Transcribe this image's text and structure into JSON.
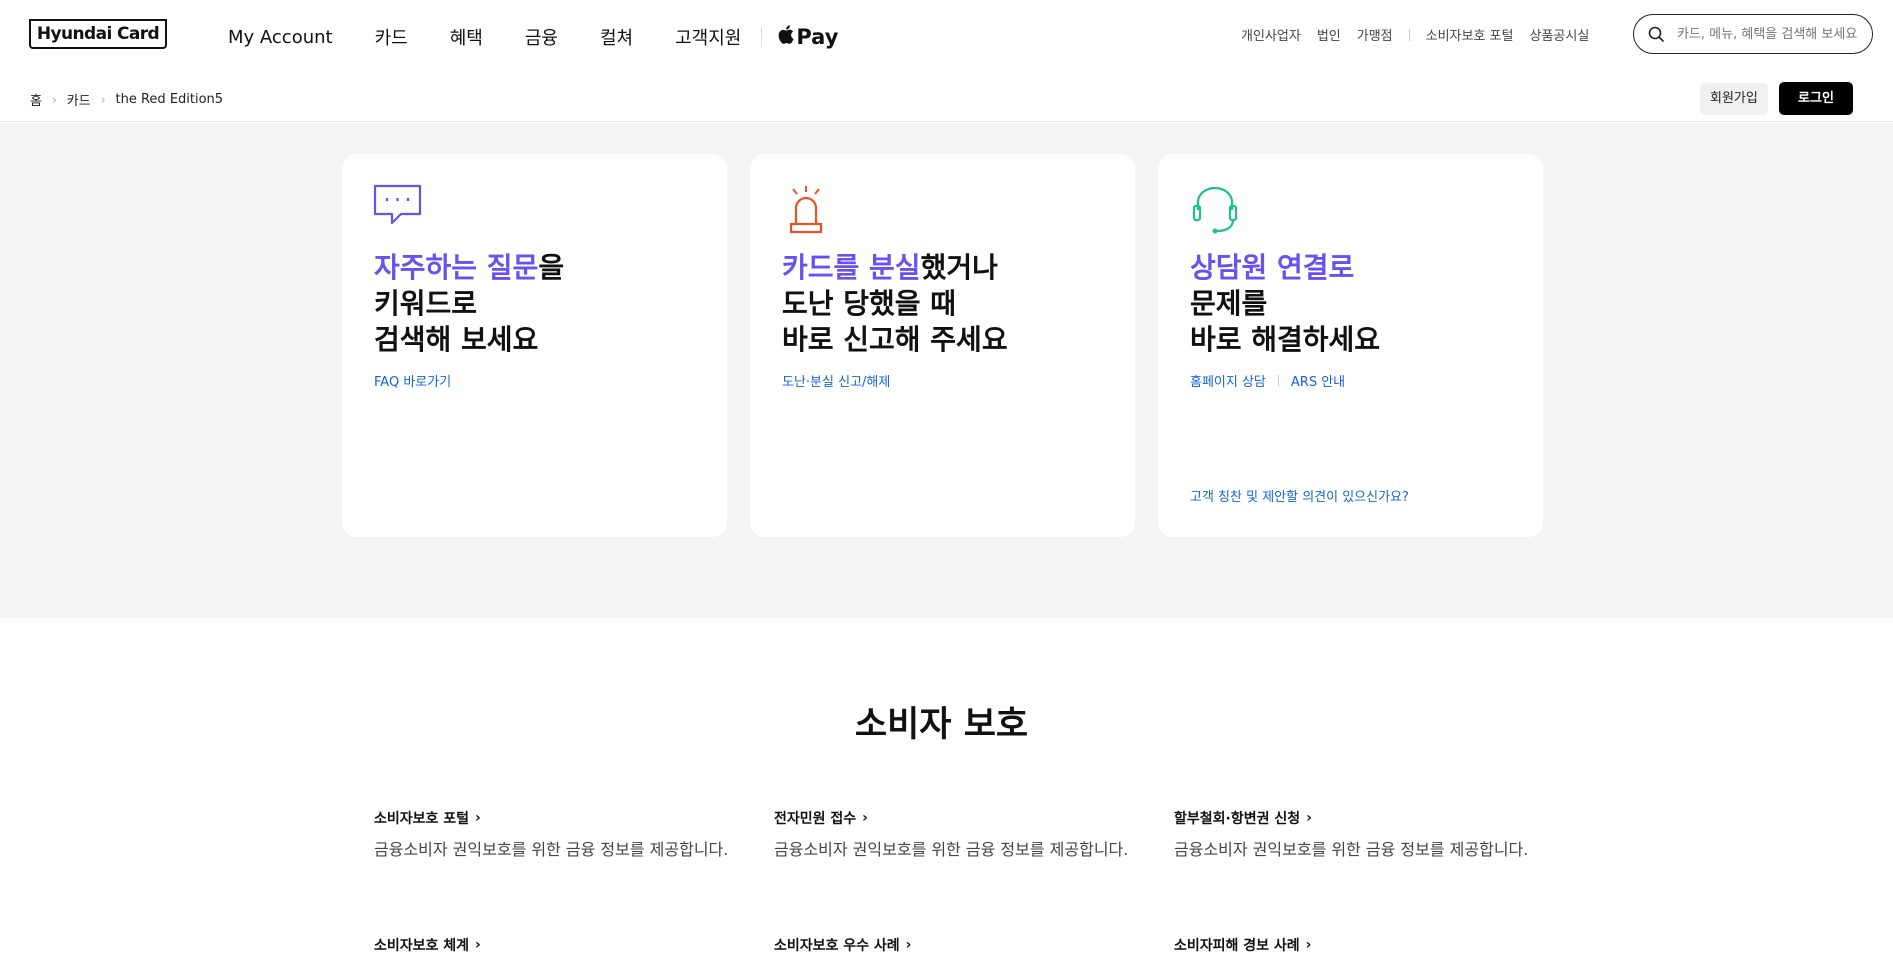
{
  "header": {
    "logo": "Hyundai Card",
    "nav": [
      "My Account",
      "카드",
      "혜택",
      "금융",
      "컬쳐",
      "고객지원"
    ],
    "applepay": "Pay",
    "util": [
      "개인사업자",
      "법인",
      "가맹점",
      "소비자보호 포털",
      "상품공시실"
    ],
    "search_placeholder": "카드, 메뉴, 혜택을 검색해 보세요"
  },
  "breadcrumb": [
    "홈",
    "카드",
    "the Red Edition5"
  ],
  "auth": {
    "join": "회원가입",
    "login": "로그인"
  },
  "cards": [
    {
      "title_hl": "자주하는 질문",
      "title_rest": "을",
      "line2": "키워드로",
      "line3": "검색해 보세요",
      "links": [
        "FAQ 바로가기"
      ]
    },
    {
      "title_hl": "카드를 분실",
      "title_rest": "했거나",
      "line2": "도난 당했을 때",
      "line3": "바로 신고해 주세요",
      "links": [
        "도난·분실 신고/해제"
      ]
    },
    {
      "title_hl": "상담원 연결로",
      "title_rest": "",
      "line2": "문제를",
      "line3": "바로 해결하세요",
      "links": [
        "홈페이지 상담",
        "ARS 안내"
      ],
      "bottom_link": "고객 칭찬 및 제안할 의견이 있으신가요?"
    }
  ],
  "consumer": {
    "title": "소비자 보호",
    "items": [
      {
        "title": "소비자보호 포털",
        "desc": "금융소비자 권익보호를 위한 금융 정보를 제공합니다."
      },
      {
        "title": "전자민원 접수",
        "desc": "금융소비자 권익보호를 위한 금융 정보를 제공합니다."
      },
      {
        "title": "할부철회·항변권 신청",
        "desc": "금융소비자 권익보호를 위한 금융 정보를 제공합니다."
      },
      {
        "title": "소비자보호 체계",
        "desc": ""
      },
      {
        "title": "소비자보호 우수 사례",
        "desc": ""
      },
      {
        "title": "소비자피해 경보 사례",
        "desc": ""
      }
    ]
  },
  "colors": {
    "accent": "#6b50f0",
    "link": "#1565d8",
    "alarm": "#f04e23",
    "headset": "#1fbf8f",
    "bg_gray": "#f4f4f4"
  }
}
